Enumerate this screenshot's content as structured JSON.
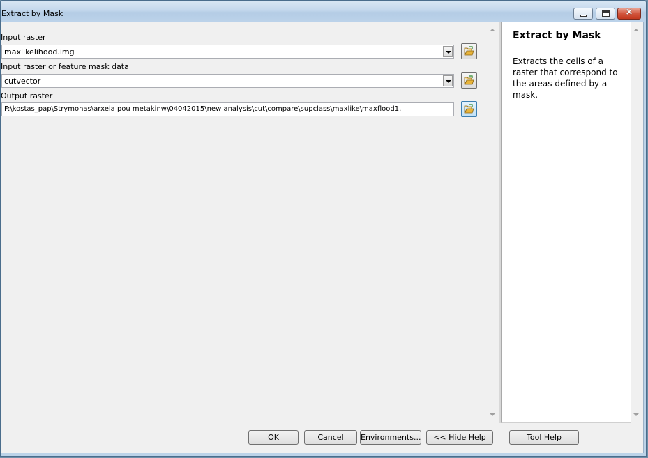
{
  "window": {
    "title": "Extract by Mask",
    "controls": {
      "minimize": "minimize-icon",
      "maximize": "maximize-icon",
      "close": "×"
    }
  },
  "form": {
    "input_raster": {
      "label": "Input raster",
      "value": "maxlikelihood.img"
    },
    "mask_data": {
      "label": "Input raster or feature mask data",
      "value": "cutvector"
    },
    "output_raster": {
      "label": "Output raster",
      "value": "F:\\kostas_pap\\Strymonas\\arxeia pou metakinw\\04042015\\new analysis\\cut\\compare\\supclass\\maxlike\\maxflood1."
    }
  },
  "help": {
    "title": "Extract by Mask",
    "body": "Extracts the cells of a raster that correspond to the areas defined by a mask."
  },
  "buttons": {
    "ok": "OK",
    "cancel": "Cancel",
    "environments": "Environments...",
    "hide_help": "<< Hide Help",
    "tool_help": "Tool Help"
  },
  "icons": {
    "browse": "folder-open-icon",
    "dropdown": "chevron-down-icon"
  },
  "colors": {
    "titlebar": "#bcd3ea",
    "close_button": "#c3391f",
    "folder": "#f2c94c"
  }
}
